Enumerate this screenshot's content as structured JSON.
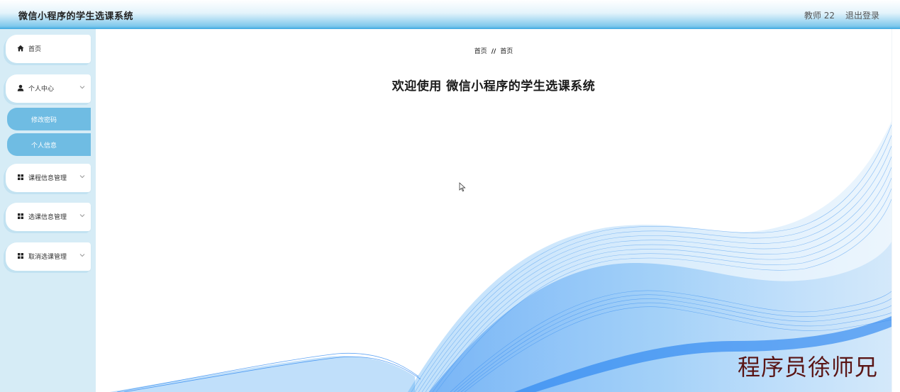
{
  "header": {
    "app_title": "微信小程序的学生选课系统",
    "user_label": "教师 22",
    "logout_label": "退出登录"
  },
  "sidebar": {
    "items": [
      {
        "label": "首页",
        "icon": "home-icon"
      },
      {
        "label": "个人中心",
        "icon": "user-icon",
        "expanded": true,
        "children": [
          {
            "label": "修改密码"
          },
          {
            "label": "个人信息"
          }
        ]
      },
      {
        "label": "课程信息管理",
        "icon": "grid-icon"
      },
      {
        "label": "选课信息管理",
        "icon": "grid-icon"
      },
      {
        "label": "取消选课管理",
        "icon": "grid-icon"
      }
    ]
  },
  "main": {
    "breadcrumb": {
      "first": "首页",
      "separator": "//",
      "second": "首页"
    },
    "welcome_text": "欢迎使用 微信小程序的学生选课系统"
  },
  "watermark": "程序员徐师兄",
  "colors": {
    "accent": "#6fbce3",
    "header_gradient_end": "#3da8e0",
    "sidebar_bg": "#d6ecf6",
    "wave_blue": "#1f7ff0",
    "watermark": "#5a1515"
  }
}
